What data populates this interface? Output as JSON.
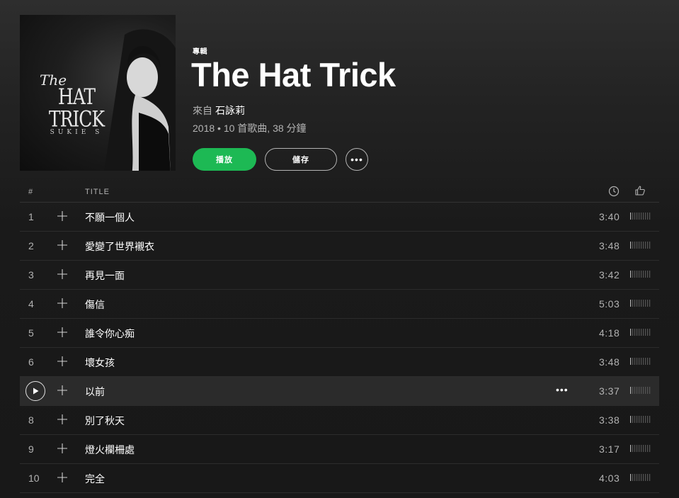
{
  "album": {
    "type_label": "專輯",
    "title": "The Hat Trick",
    "by_prefix": "來自",
    "artist": "石詠莉",
    "meta": "2018 • 10 首歌曲, 38 分鐘",
    "cover": {
      "the": "The",
      "title": "HAT TRICK",
      "artist": "SUKIE S"
    }
  },
  "actions": {
    "play_label": "播放",
    "save_label": "儲存",
    "more_label": "•••"
  },
  "table": {
    "col_num": "#",
    "col_title": "TITLE",
    "clock_icon": "clock-icon",
    "thumb_icon": "thumbs-up-icon"
  },
  "tracks": [
    {
      "num": "1",
      "title": "不願一個人",
      "duration": "3:40"
    },
    {
      "num": "2",
      "title": "愛變了世界襯衣",
      "duration": "3:48"
    },
    {
      "num": "3",
      "title": "再見一面",
      "duration": "3:42"
    },
    {
      "num": "4",
      "title": "傷信",
      "duration": "5:03"
    },
    {
      "num": "5",
      "title": "誰令你心痴",
      "duration": "4:18"
    },
    {
      "num": "6",
      "title": "壞女孩",
      "duration": "3:48"
    },
    {
      "num": "7",
      "title": "以前",
      "duration": "3:37",
      "active": true,
      "more": "•••"
    },
    {
      "num": "8",
      "title": "別了秋天",
      "duration": "3:38"
    },
    {
      "num": "9",
      "title": "燈火欄柵處",
      "duration": "3:17"
    },
    {
      "num": "10",
      "title": "完全",
      "duration": "4:03"
    }
  ],
  "colors": {
    "accent": "#1db954",
    "background": "#181818",
    "text_muted": "#b3b3b3"
  }
}
